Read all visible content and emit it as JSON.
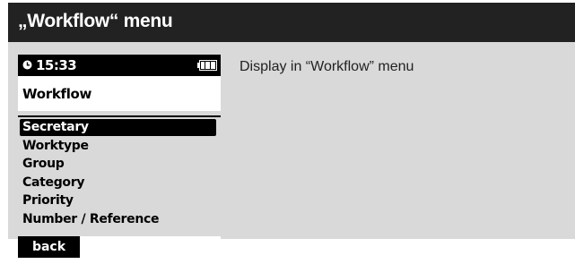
{
  "page": {
    "title": "„Workflow“ menu",
    "description": "Display in “Workflow” menu"
  },
  "device": {
    "status": {
      "time": "15:33",
      "clock_icon": "clock-icon",
      "battery_icon": "battery-full-icon"
    },
    "screen_title": "Workflow",
    "menu_items": [
      {
        "label": "Secretary",
        "selected": true
      },
      {
        "label": "Worktype",
        "selected": false
      },
      {
        "label": "Group",
        "selected": false
      },
      {
        "label": "Category",
        "selected": false
      },
      {
        "label": "Priority",
        "selected": false
      },
      {
        "label": "Number / Reference",
        "selected": false
      }
    ],
    "softkey_label": "back"
  },
  "colors": {
    "title_bar": "#222222",
    "panel_bg": "#d9d9d9",
    "highlight": "#000000",
    "screen_bg": "#ffffff"
  }
}
